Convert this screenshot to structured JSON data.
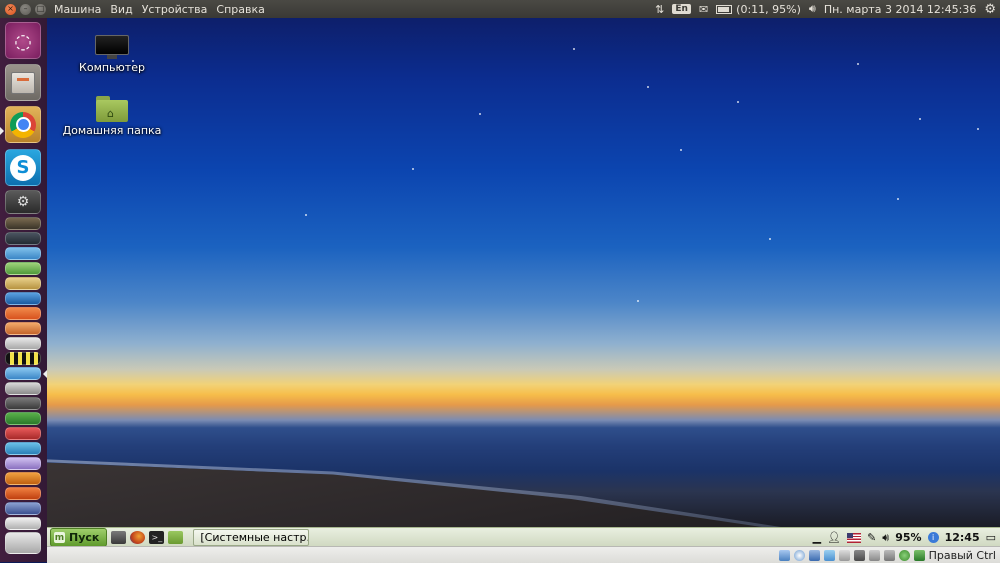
{
  "top_panel": {
    "menu": [
      "Машина",
      "Вид",
      "Устройства",
      "Справка"
    ],
    "keyboard_layout": "En",
    "battery": "(0:11, 95%)",
    "datetime": "Пн. марта  3 2014 12:45:36"
  },
  "desktop": {
    "icons": [
      {
        "label": "Компьютер",
        "icon": "monitor-icon"
      },
      {
        "label": "Домашняя папка",
        "icon": "home-folder-icon"
      }
    ]
  },
  "launcher": {
    "items": [
      {
        "name": "ubuntu-dash",
        "color": "#8e2f6f"
      },
      {
        "name": "file-cabinet",
        "color": "#c8c4bd"
      },
      {
        "name": "chrome",
        "color": "#d9a23a"
      },
      {
        "name": "skype",
        "color": "#1ea3e0"
      },
      {
        "name": "steam",
        "color": "#3a3a3a"
      }
    ]
  },
  "bottom_panel": {
    "start_label": "Пуск",
    "task_label": "[Системные настр...",
    "battery_percent": "95%",
    "clock": "12:45"
  },
  "vbox_bar": {
    "host_key": "Правый Ctrl"
  }
}
